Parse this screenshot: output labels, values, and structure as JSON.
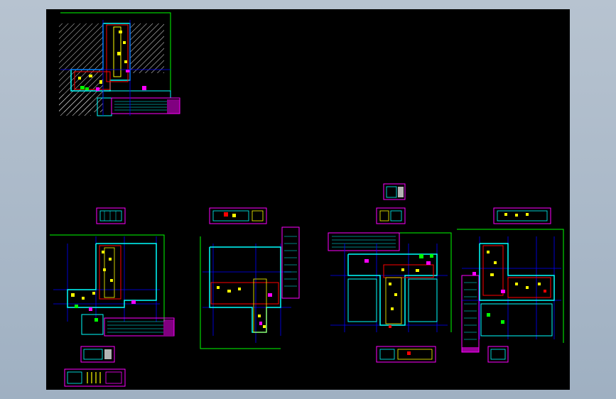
{
  "colors": {
    "background_frame": "#b7c3d0",
    "model_space": "#000000",
    "wall_lines": "#00ffff",
    "grid_lines": "#0000ff",
    "dimension_lines": "#00ff00",
    "annotation": "#ff00ff",
    "fixtures": "#ffff00",
    "details": "#ff0000",
    "hatch": "#ffffff"
  },
  "drawing": {
    "plans": [
      {
        "name": "site-plan-with-hatch"
      },
      {
        "name": "floor-plan-1"
      },
      {
        "name": "floor-plan-2"
      },
      {
        "name": "floor-plan-3"
      },
      {
        "name": "floor-plan-4"
      }
    ],
    "detail_blocks": [
      {
        "name": "detail-block-1"
      },
      {
        "name": "detail-block-2"
      },
      {
        "name": "detail-block-3"
      },
      {
        "name": "detail-block-4"
      },
      {
        "name": "detail-block-5"
      },
      {
        "name": "detail-block-6"
      },
      {
        "name": "detail-block-7"
      },
      {
        "name": "detail-block-8"
      },
      {
        "name": "detail-block-9"
      },
      {
        "name": "detail-block-10"
      }
    ]
  }
}
